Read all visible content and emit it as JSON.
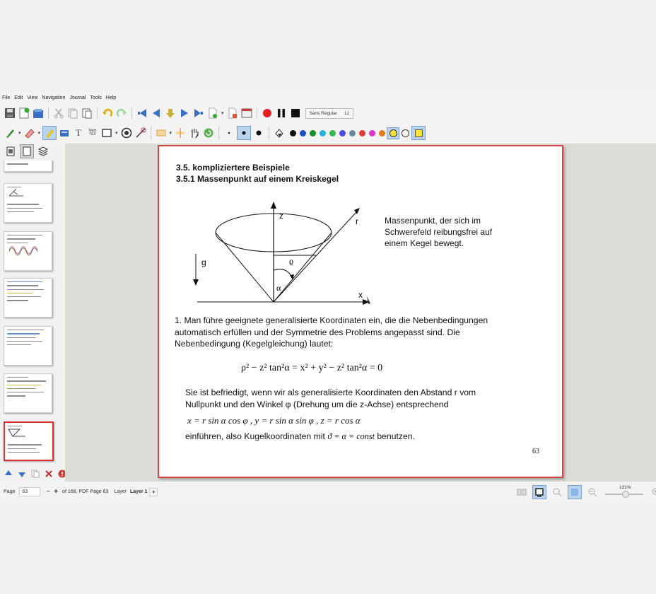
{
  "menu": [
    "File",
    "Edit",
    "View",
    "Navigation",
    "Journal",
    "Tools",
    "Help"
  ],
  "toolbar": {
    "font_name": "Sans Regular",
    "font_size": "12",
    "math_tex_label": "Math\nTEX",
    "text_tool_label": "T",
    "pen_colors": [
      "#111111",
      "#1f4fc7",
      "#1b8a2a",
      "#2ab0e0",
      "#3ab74a",
      "#4a4ae0",
      "#6a8a9a",
      "#e03a3a",
      "#e034c8",
      "#e07a20",
      "#f5e23a",
      "#ffffff"
    ],
    "highlight_color": "#f5e23a"
  },
  "page": {
    "heading1": "3.5. kompliziertere Beispiele",
    "heading2": "3.5.1 Massenpunkt auf einem Kreiskegel",
    "figure": {
      "z": "z",
      "r": "r",
      "g": "g",
      "rho": "ϱ",
      "alpha": "α",
      "x": "x"
    },
    "caption_lines": [
      "Massenpunkt, der sich im",
      "Schwerefeld reibungsfrei auf",
      "einem Kegel bewegt."
    ],
    "paragraph_lines": [
      "1. Man führe geeignete generalisierte Koordinaten ein, die die Nebenbedingungen",
      "automatisch erfüllen und der Symmetrie des Problems angepasst sind. Die",
      "Nebenbedingung (Kegelgleichung) lautet:"
    ],
    "equation": "ρ² − z² tan²α  =  x² + y² − z² tan²α  =  0",
    "para2_lines": [
      "Sie ist befriedigt, wenn wir als generalisierte Koordinaten den Abstand  r  vom",
      "Nullpunkt und den Winkel  φ  (Drehung um die z-Achse) entsprechend"
    ],
    "equation2": "x = r sin α cos φ ,   y = r sin α sin φ ,   z = r cos α",
    "final_line_pre": "einführen, also Kugelkoordinaten mit",
    "final_line_math": "ϑ = α = const",
    "final_line_post": "benutzen.",
    "page_number": "63"
  },
  "status": {
    "page_label": "Page",
    "page_value": "63",
    "minus": "−",
    "plus": "+",
    "of_pages": "of 168, PDF Page 63",
    "layer_label": "Layer",
    "layer_value": "Layer 1",
    "zoom": "131%"
  }
}
